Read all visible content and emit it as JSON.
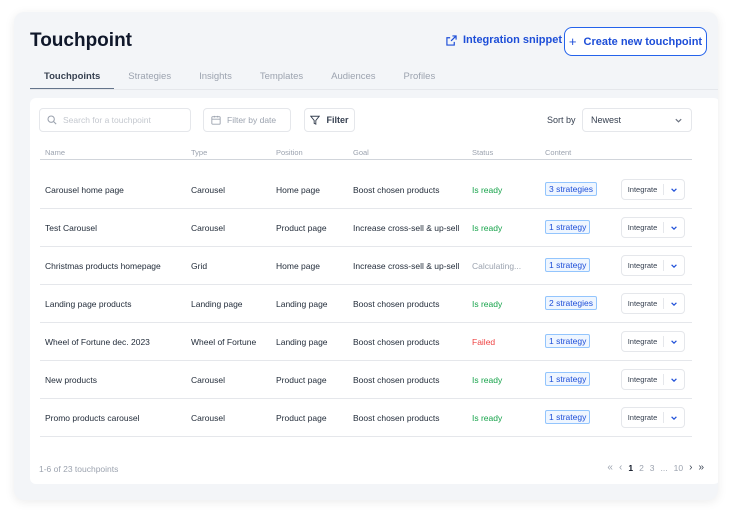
{
  "header": {
    "title": "Touchpoint",
    "snippet_label": "Integration snippet",
    "create_label": "Create new touchpoint"
  },
  "tabs": [
    {
      "label": "Touchpoints",
      "active": true
    },
    {
      "label": "Strategies",
      "active": false
    },
    {
      "label": "Insights",
      "active": false
    },
    {
      "label": "Templates",
      "active": false
    },
    {
      "label": "Audiences",
      "active": false
    },
    {
      "label": "Profiles",
      "active": false
    }
  ],
  "toolbar": {
    "search_placeholder": "Search for a touchpoint",
    "date_placeholder": "Filter by date",
    "filter_label": "Filter",
    "sort_label": "Sort by",
    "sort_value": "Newest"
  },
  "table": {
    "columns": [
      "Name",
      "Type",
      "Position",
      "Goal",
      "Status",
      "Content"
    ],
    "integrate_label": "Integrate",
    "rows": [
      {
        "name": "Carousel home page",
        "type": "Carousel",
        "position": "Home page",
        "goal": "Boost chosen products",
        "status": "Is ready",
        "status_kind": "ready",
        "content": "3 strategies"
      },
      {
        "name": "Test Carousel",
        "type": "Carousel",
        "position": "Product page",
        "goal": "Increase cross-sell & up-sell",
        "status": "Is ready",
        "status_kind": "ready",
        "content": "1 strategy"
      },
      {
        "name": "Christmas products homepage",
        "type": "Grid",
        "position": "Home page",
        "goal": "Increase cross-sell & up-sell",
        "status": "Calculating...",
        "status_kind": "calc",
        "content": "1 strategy"
      },
      {
        "name": "Landing page products",
        "type": "Landing page",
        "position": "Landing page",
        "goal": "Boost chosen products",
        "status": "Is ready",
        "status_kind": "ready",
        "content": "2 strategies"
      },
      {
        "name": "Wheel of Fortune dec. 2023",
        "type": "Wheel of Fortune",
        "position": "Landing page",
        "goal": "Boost chosen products",
        "status": "Failed",
        "status_kind": "failed",
        "content": "1 strategy"
      },
      {
        "name": "New products",
        "type": "Carousel",
        "position": "Product page",
        "goal": "Boost chosen products",
        "status": "Is ready",
        "status_kind": "ready",
        "content": "1 strategy"
      },
      {
        "name": "Promo products carousel",
        "type": "Carousel",
        "position": "Product page",
        "goal": "Boost chosen products",
        "status": "Is ready",
        "status_kind": "ready",
        "content": "1 strategy"
      }
    ]
  },
  "footer": {
    "count_text": "1-6 of 23 touchpoints",
    "pages": [
      "1",
      "2",
      "3",
      "...",
      "10"
    ],
    "current_page": "1"
  },
  "icons": {
    "snippet": "external-link-icon",
    "create": "plus-icon",
    "search": "search-icon",
    "date": "calendar-icon",
    "filter": "funnel-icon",
    "sort": "chevron-down-icon"
  },
  "colors": {
    "accent": "#1d4ed8",
    "ready": "#16a34a",
    "failed": "#ef4444",
    "muted": "#9ca3af"
  }
}
